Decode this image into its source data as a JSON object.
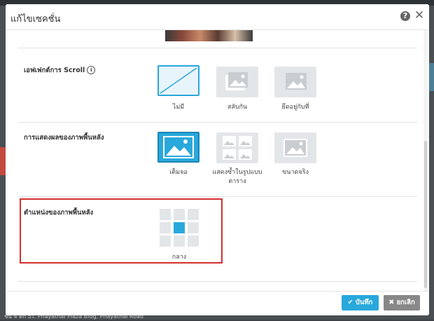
{
  "dialog": {
    "title": "แก้ไขเซคชั่น",
    "help_icon": "question-circle-icon",
    "close_icon": "close-x-icon"
  },
  "scroll_effect": {
    "label": "เอฟเฟกต์การ Scroll",
    "info_glyph": "i",
    "options": [
      {
        "label": "ไม่มี",
        "icon": "none-diagonal-icon",
        "selected": true
      },
      {
        "label": "สลับกัน",
        "icon": "parallax-image-icon",
        "selected": false
      },
      {
        "label": "ยึดอยู่กับที่",
        "icon": "fixed-image-icon",
        "selected": false
      }
    ]
  },
  "background_display": {
    "label": "การแสดงผลของภาพพื้นหลัง",
    "options": [
      {
        "label": "เต็มจอ",
        "icon": "fullscreen-image-icon",
        "selected": true
      },
      {
        "label": "แสดงซ้ำในรูปแบบตาราง",
        "icon": "tiled-image-icon",
        "selected": false
      },
      {
        "label": "ขนาดจริง",
        "icon": "actual-size-image-icon",
        "selected": false
      }
    ]
  },
  "background_position": {
    "label": "ตำแหน่งของภาพพื้นหลัง",
    "grid_selected_index": 4,
    "selected_label": "กลาง"
  },
  "footer": {
    "save_label": "บันทึก",
    "cancel_label": "ยกเลิก",
    "save_icon": "check-icon",
    "cancel_icon": "x-icon"
  },
  "background_text": "ชั้น 4 ตึก ST. Phayathai Plaza Bldg. Phayathai Road",
  "colors": {
    "accent": "#29a8dc",
    "highlight_border": "#d32f2f",
    "cancel_button": "#888888"
  }
}
